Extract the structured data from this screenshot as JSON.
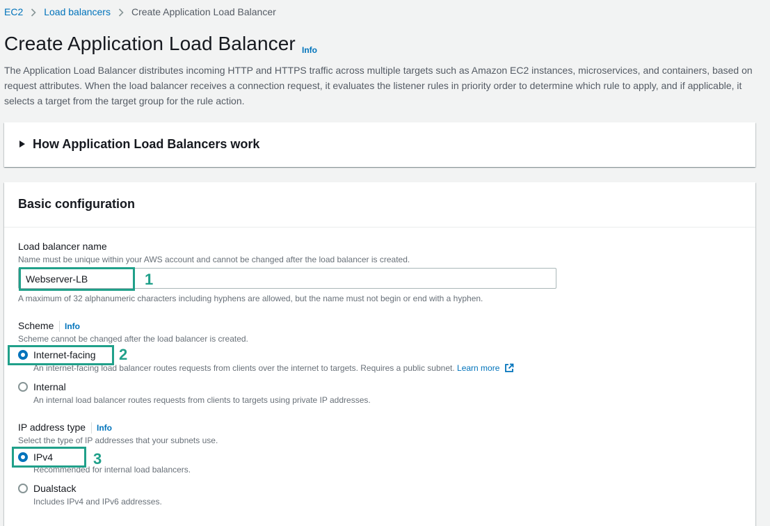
{
  "breadcrumb": {
    "items": [
      "EC2",
      "Load balancers"
    ],
    "current": "Create Application Load Balancer"
  },
  "page": {
    "title": "Create Application Load Balancer",
    "info_label": "Info",
    "description": "The Application Load Balancer distributes incoming HTTP and HTTPS traffic across multiple targets such as Amazon EC2 instances, microservices, and containers, based on request attributes. When the load balancer receives a connection request, it evaluates the listener rules in priority order to determine which rule to apply, and if applicable, it selects a target from the target group for the rule action."
  },
  "how_panel": {
    "title": "How Application Load Balancers work"
  },
  "basic": {
    "title": "Basic configuration",
    "name": {
      "label": "Load balancer name",
      "hint": "Name must be unique within your AWS account and cannot be changed after the load balancer is created.",
      "value": "Webserver-LB",
      "constraint": "A maximum of 32 alphanumeric characters including hyphens are allowed, but the name must not begin or end with a hyphen."
    },
    "scheme": {
      "label": "Scheme",
      "info_label": "Info",
      "hint": "Scheme cannot be changed after the load balancer is created.",
      "options": [
        {
          "label": "Internet-facing",
          "desc": "An internet-facing load balancer routes requests from clients over the internet to targets. Requires a public subnet.",
          "link": "Learn more",
          "selected": true
        },
        {
          "label": "Internal",
          "desc": "An internal load balancer routes requests from clients to targets using private IP addresses.",
          "selected": false
        }
      ]
    },
    "ip_type": {
      "label": "IP address type",
      "info_label": "Info",
      "hint": "Select the type of IP addresses that your subnets use.",
      "options": [
        {
          "label": "IPv4",
          "desc": "Recommended for internal load balancers.",
          "selected": true
        },
        {
          "label": "Dualstack",
          "desc": "Includes IPv4 and IPv6 addresses.",
          "selected": false
        }
      ]
    }
  },
  "annotations": [
    "1",
    "2",
    "3"
  ],
  "colors": {
    "link": "#0073bb",
    "annotation": "#20a08a",
    "background": "#f2f3f3"
  }
}
